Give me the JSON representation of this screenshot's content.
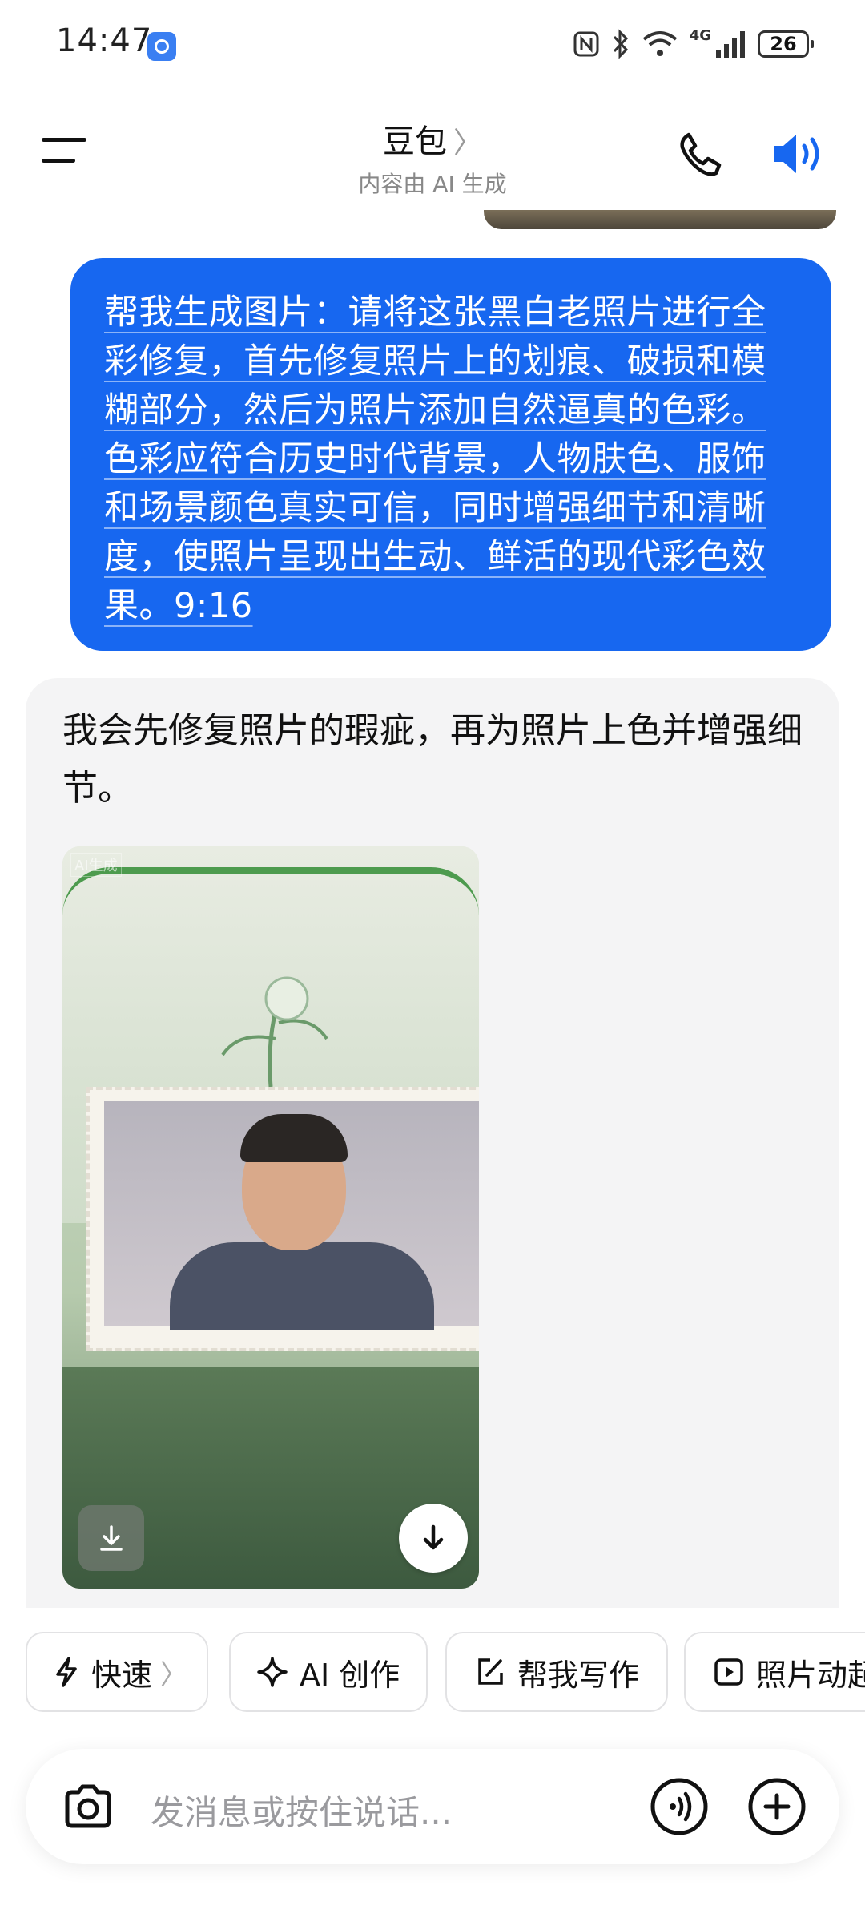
{
  "status_bar": {
    "time": "14:47",
    "network": "4G",
    "battery": "26"
  },
  "header": {
    "title": "豆包",
    "title_chevron": "〉",
    "subtitle": "内容由 AI 生成",
    "icons": [
      "menu-icon",
      "phone-icon",
      "speaker-icon"
    ],
    "accent_color": "#1767f0"
  },
  "conversation": {
    "user_message": "帮我生成图片：请将这张黑白老照片进行全彩修复，首先修复照片上的划痕、破损和模糊部分，然后为照片添加自然逼真的色彩。色彩应符合历史时代背景，人物肤色、服饰和场景颜色真实可信，同时增强细节和清晰度，使照片呈现出生动、鲜活的现代彩色效果。9:16",
    "bot_message": "我会先修复照片的瑕疵，再为照片上色并增强细节。",
    "image": {
      "watermark": "AI生成",
      "icons": [
        "download-icon",
        "download-icon"
      ]
    }
  },
  "quick_actions": [
    {
      "label": "快速",
      "icon": "lightning-icon",
      "chevron": "〉"
    },
    {
      "label": "AI 创作",
      "icon": "sparkle-icon"
    },
    {
      "label": "帮我写作",
      "icon": "edit-icon"
    },
    {
      "label": "照片动起",
      "icon": "play-icon"
    }
  ],
  "input": {
    "placeholder": "发消息或按住说话...",
    "icons": [
      "camera-icon",
      "voice-call-icon",
      "plus-icon"
    ]
  }
}
